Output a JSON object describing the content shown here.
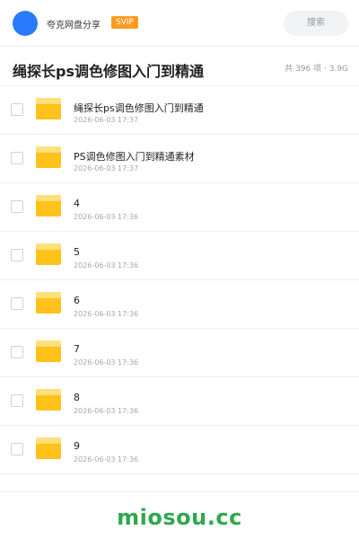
{
  "header": {
    "app_name": "夸克网盘分享",
    "badge": "SVIP",
    "search_label": "搜索",
    "avatar_color": "#2b7bff",
    "badge_color": "#ff9a1f"
  },
  "share": {
    "title": "绳探长ps调色修图入门到精通",
    "meta": "共 396 项 · 3.9G"
  },
  "items": [
    {
      "name": "绳探长ps调色修图入门到精通",
      "time": "2026-06-03 17:37",
      "icon": "folder-icon"
    },
    {
      "name": "PS调色修图入门到精通素材",
      "time": "2026-06-03 17:37",
      "icon": "folder-icon"
    },
    {
      "name": "4",
      "time": "2026-06-03 17:36",
      "icon": "folder-icon"
    },
    {
      "name": "5",
      "time": "2026-06-03 17:36",
      "icon": "folder-icon"
    },
    {
      "name": "6",
      "time": "2026-06-03 17:36",
      "icon": "folder-icon"
    },
    {
      "name": "7",
      "time": "2026-06-03 17:36",
      "icon": "folder-icon"
    },
    {
      "name": "8",
      "time": "2026-06-03 17:36",
      "icon": "folder-icon"
    },
    {
      "name": "9",
      "time": "2026-06-03 17:36",
      "icon": "folder-icon"
    }
  ],
  "footer": {
    "watermark": "miosou.cc",
    "watermark_color": "#2ea84f"
  },
  "colors": {
    "folder_body": "#ffc21a",
    "folder_tab": "#ffe07a"
  }
}
